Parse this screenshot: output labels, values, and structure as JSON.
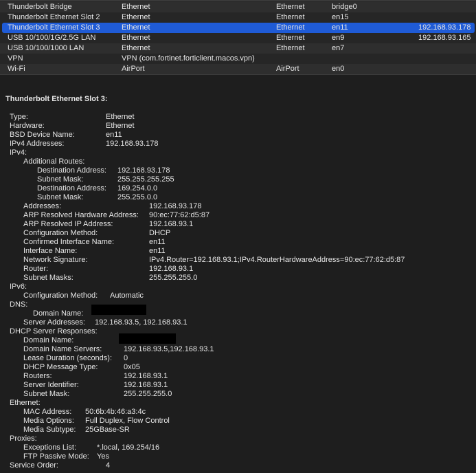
{
  "interfaces": [
    {
      "name": "Thunderbolt Bridge",
      "type": "Ethernet",
      "hardware": "Ethernet",
      "bsd": "bridge0",
      "ip": ""
    },
    {
      "name": "Thunderbolt Ethernet Slot 2",
      "type": "Ethernet",
      "hardware": "Ethernet",
      "bsd": "en15",
      "ip": ""
    },
    {
      "name": "Thunderbolt Ethernet Slot 3",
      "type": "Ethernet",
      "hardware": "Ethernet",
      "bsd": "en11",
      "ip": "192.168.93.178"
    },
    {
      "name": "USB 10/100/1G/2.5G LAN",
      "type": "Ethernet",
      "hardware": "Ethernet",
      "bsd": "en9",
      "ip": "192.168.93.165"
    },
    {
      "name": "USB 10/100/1000 LAN",
      "type": "Ethernet",
      "hardware": "Ethernet",
      "bsd": "en7",
      "ip": ""
    },
    {
      "name": "VPN",
      "type": "VPN (com.fortinet.forticlient.macos.vpn)",
      "hardware": "",
      "bsd": "",
      "ip": ""
    },
    {
      "name": "Wi-Fi",
      "type": "AirPort",
      "hardware": "AirPort",
      "bsd": "en0",
      "ip": ""
    }
  ],
  "selected_index": 2,
  "detail": {
    "title": "Thunderbolt Ethernet Slot 3:",
    "lines": [
      {
        "label": "Type:",
        "value": "Ethernet"
      },
      {
        "label": "Hardware:",
        "value": "Ethernet"
      },
      {
        "label": "BSD Device Name:",
        "value": "en11"
      },
      {
        "label": "IPv4 Addresses:",
        "value": "192.168.93.178"
      },
      {
        "label": "IPv4:",
        "value": ""
      },
      {
        "label": "Additional Routes:",
        "value": ""
      },
      {
        "label": "Destination Address:",
        "value": "192.168.93.178"
      },
      {
        "label": "Subnet Mask:",
        "value": "255.255.255.255"
      },
      {
        "label": "Destination Address:",
        "value": "169.254.0.0"
      },
      {
        "label": "Subnet Mask:",
        "value": "255.255.0.0"
      },
      {
        "label": "Addresses:",
        "value": "192.168.93.178"
      },
      {
        "label": "ARP Resolved Hardware Address:",
        "value": "90:ec:77:62:d5:87"
      },
      {
        "label": "ARP Resolved IP Address:",
        "value": "192.168.93.1"
      },
      {
        "label": "Configuration Method:",
        "value": "DHCP"
      },
      {
        "label": "Confirmed Interface Name:",
        "value": "en11"
      },
      {
        "label": "Interface Name:",
        "value": "en11"
      },
      {
        "label": "Network Signature:",
        "value": "IPv4.Router=192.168.93.1;IPv4.RouterHardwareAddress=90:ec:77:62:d5:87"
      },
      {
        "label": "Router:",
        "value": "192.168.93.1"
      },
      {
        "label": "Subnet Masks:",
        "value": "255.255.255.0"
      },
      {
        "label": "IPv6:",
        "value": ""
      },
      {
        "label": "Configuration Method:",
        "value": "Automatic"
      },
      {
        "label": "DNS:",
        "value": ""
      },
      {
        "label": "Domain Name:",
        "value": ""
      },
      {
        "label": "Server Addresses:",
        "value": "192.168.93.5, 192.168.93.1"
      },
      {
        "label": "DHCP Server Responses:",
        "value": ""
      },
      {
        "label": "Domain Name:",
        "value": ""
      },
      {
        "label": "Domain Name Servers:",
        "value": "192.168.93.5,192.168.93.1"
      },
      {
        "label": "Lease Duration (seconds):",
        "value": "0"
      },
      {
        "label": "DHCP Message Type:",
        "value": "0x05"
      },
      {
        "label": "Routers:",
        "value": "192.168.93.1"
      },
      {
        "label": "Server Identifier:",
        "value": "192.168.93.1"
      },
      {
        "label": "Subnet Mask:",
        "value": "255.255.255.0"
      },
      {
        "label": "Ethernet:",
        "value": ""
      },
      {
        "label": "MAC Address:",
        "value": "50:6b:4b:46:a3:4c"
      },
      {
        "label": "Media Options:",
        "value": "Full Duplex, Flow Control"
      },
      {
        "label": "Media Subtype:",
        "value": "25GBase-SR"
      },
      {
        "label": "Proxies:",
        "value": ""
      },
      {
        "label": "Exceptions List:",
        "value": "*.local, 169.254/16"
      },
      {
        "label": "FTP Passive Mode:",
        "value": "Yes"
      },
      {
        "label": "Service Order:",
        "value": "4"
      }
    ]
  }
}
